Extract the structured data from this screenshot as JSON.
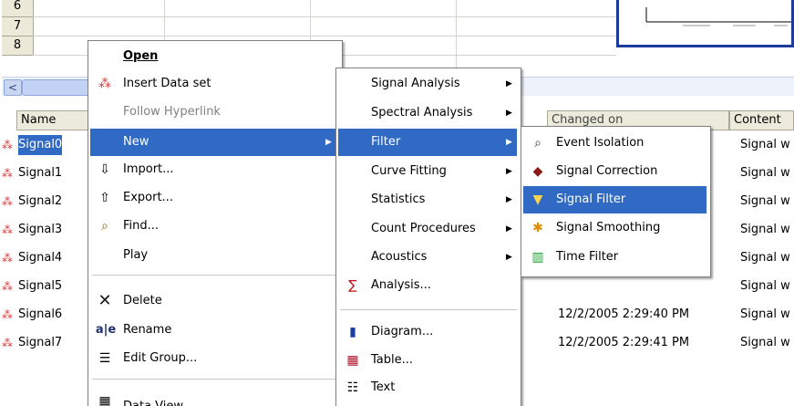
{
  "sheet": {
    "row_numbers": [
      "6",
      "7",
      "8"
    ],
    "scroll_left_glyph": "<"
  },
  "list": {
    "columns": {
      "name": "Name",
      "changed": "Changed on",
      "content": "Content"
    },
    "rows": [
      {
        "name": "Signal0",
        "changed": "",
        "content": "Signal w"
      },
      {
        "name": "Signal1",
        "changed": "",
        "content": "Signal w"
      },
      {
        "name": "Signal2",
        "changed": "",
        "content": "Signal w"
      },
      {
        "name": "Signal3",
        "changed": "",
        "content": "Signal w"
      },
      {
        "name": "Signal4",
        "changed": "",
        "content": "Signal w"
      },
      {
        "name": "Signal5",
        "changed": "",
        "content": "Signal w"
      },
      {
        "name": "Signal6",
        "changed": "12/2/2005 2:29:40 PM",
        "content": "Signal w"
      },
      {
        "name": "Signal7",
        "changed": "12/2/2005 2:29:41 PM",
        "content": "Signal w"
      }
    ]
  },
  "context_menu": {
    "open": "Open",
    "insert_data_set": "Insert Data set",
    "follow_hyperlink": "Follow Hyperlink",
    "new": "New",
    "import": "Import...",
    "export": "Export...",
    "find": "Find...",
    "play": "Play",
    "delete": "Delete",
    "rename": "Rename",
    "edit_group": "Edit Group...",
    "data_view": "Data View"
  },
  "new_submenu": {
    "signal_analysis": "Signal Analysis",
    "spectral_analysis": "Spectral Analysis",
    "filter": "Filter",
    "curve_fitting": "Curve Fitting",
    "statistics": "Statistics",
    "count_procedures": "Count Procedures",
    "acoustics": "Acoustics",
    "analysis": "Analysis...",
    "diagram": "Diagram...",
    "table": "Table...",
    "text": "Text"
  },
  "filter_submenu": {
    "event_isolation": "Event Isolation",
    "signal_correction": "Signal Correction",
    "signal_filter": "Signal Filter",
    "signal_smoothing": "Signal Smoothing",
    "time_filter": "Time Filter"
  },
  "colors": {
    "highlight": "#316ac5",
    "menu_border": "#7f7f7f",
    "header_bg": "#ebeadb"
  }
}
